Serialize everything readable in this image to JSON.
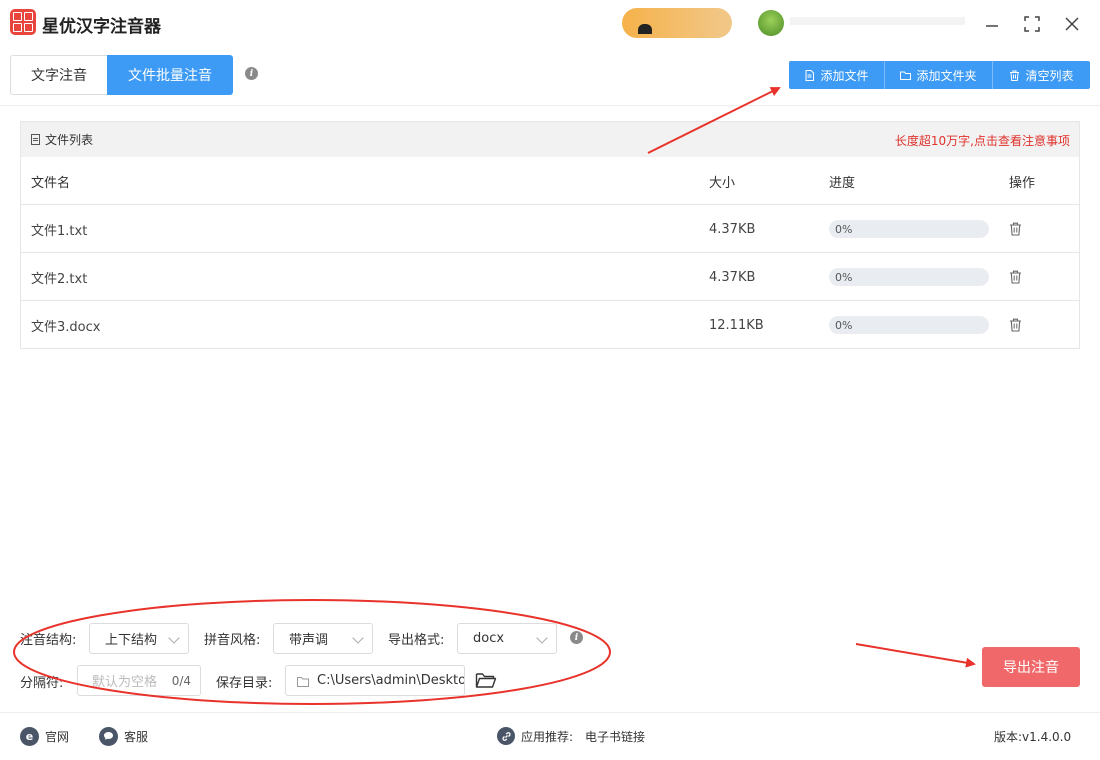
{
  "app": {
    "title": "星优汉字注音器"
  },
  "tabs": [
    {
      "label": "文字注音",
      "active": false
    },
    {
      "label": "文件批量注音",
      "active": true
    }
  ],
  "toolbar": {
    "add_file": "添加文件",
    "add_folder": "添加文件夹",
    "clear_list": "清空列表"
  },
  "file_list": {
    "title": "文件列表",
    "warning_link": "长度超10万字,点击查看注意事项",
    "columns": {
      "name": "文件名",
      "size": "大小",
      "progress": "进度",
      "action": "操作"
    },
    "rows": [
      {
        "name": "文件1.txt",
        "size": "4.37KB",
        "progress": "0%"
      },
      {
        "name": "文件2.txt",
        "size": "4.37KB",
        "progress": "0%"
      },
      {
        "name": "文件3.docx",
        "size": "12.11KB",
        "progress": "0%"
      }
    ]
  },
  "options": {
    "structure_label": "注音结构:",
    "structure_value": "上下结构",
    "style_label": "拼音风格:",
    "style_value": "带声调",
    "format_label": "导出格式:",
    "format_value": "docx",
    "separator_label": "分隔符:",
    "separator_placeholder": "默认为空格",
    "separator_count": "0/4",
    "save_dir_label": "保存目录:",
    "save_dir_value": "C:\\Users\\admin\\Deskto"
  },
  "export_button": "导出注音",
  "footer": {
    "website": "官网",
    "support": "客服",
    "recommend_label": "应用推荐:",
    "recommend_link": "电子书链接",
    "version": "版本:v1.4.0.0"
  },
  "colors": {
    "accent": "#3d9bf5",
    "export": "#f0686a",
    "warning": "#e0322c",
    "annotation": "#e8322b"
  },
  "icons": {
    "logo": "app-logo-icon",
    "info": "info-icon",
    "file": "file-icon",
    "folder": "folder-icon",
    "trash": "trash-icon",
    "website": "edge-browser-icon",
    "support": "chat-bubble-icon",
    "link": "link-icon"
  }
}
